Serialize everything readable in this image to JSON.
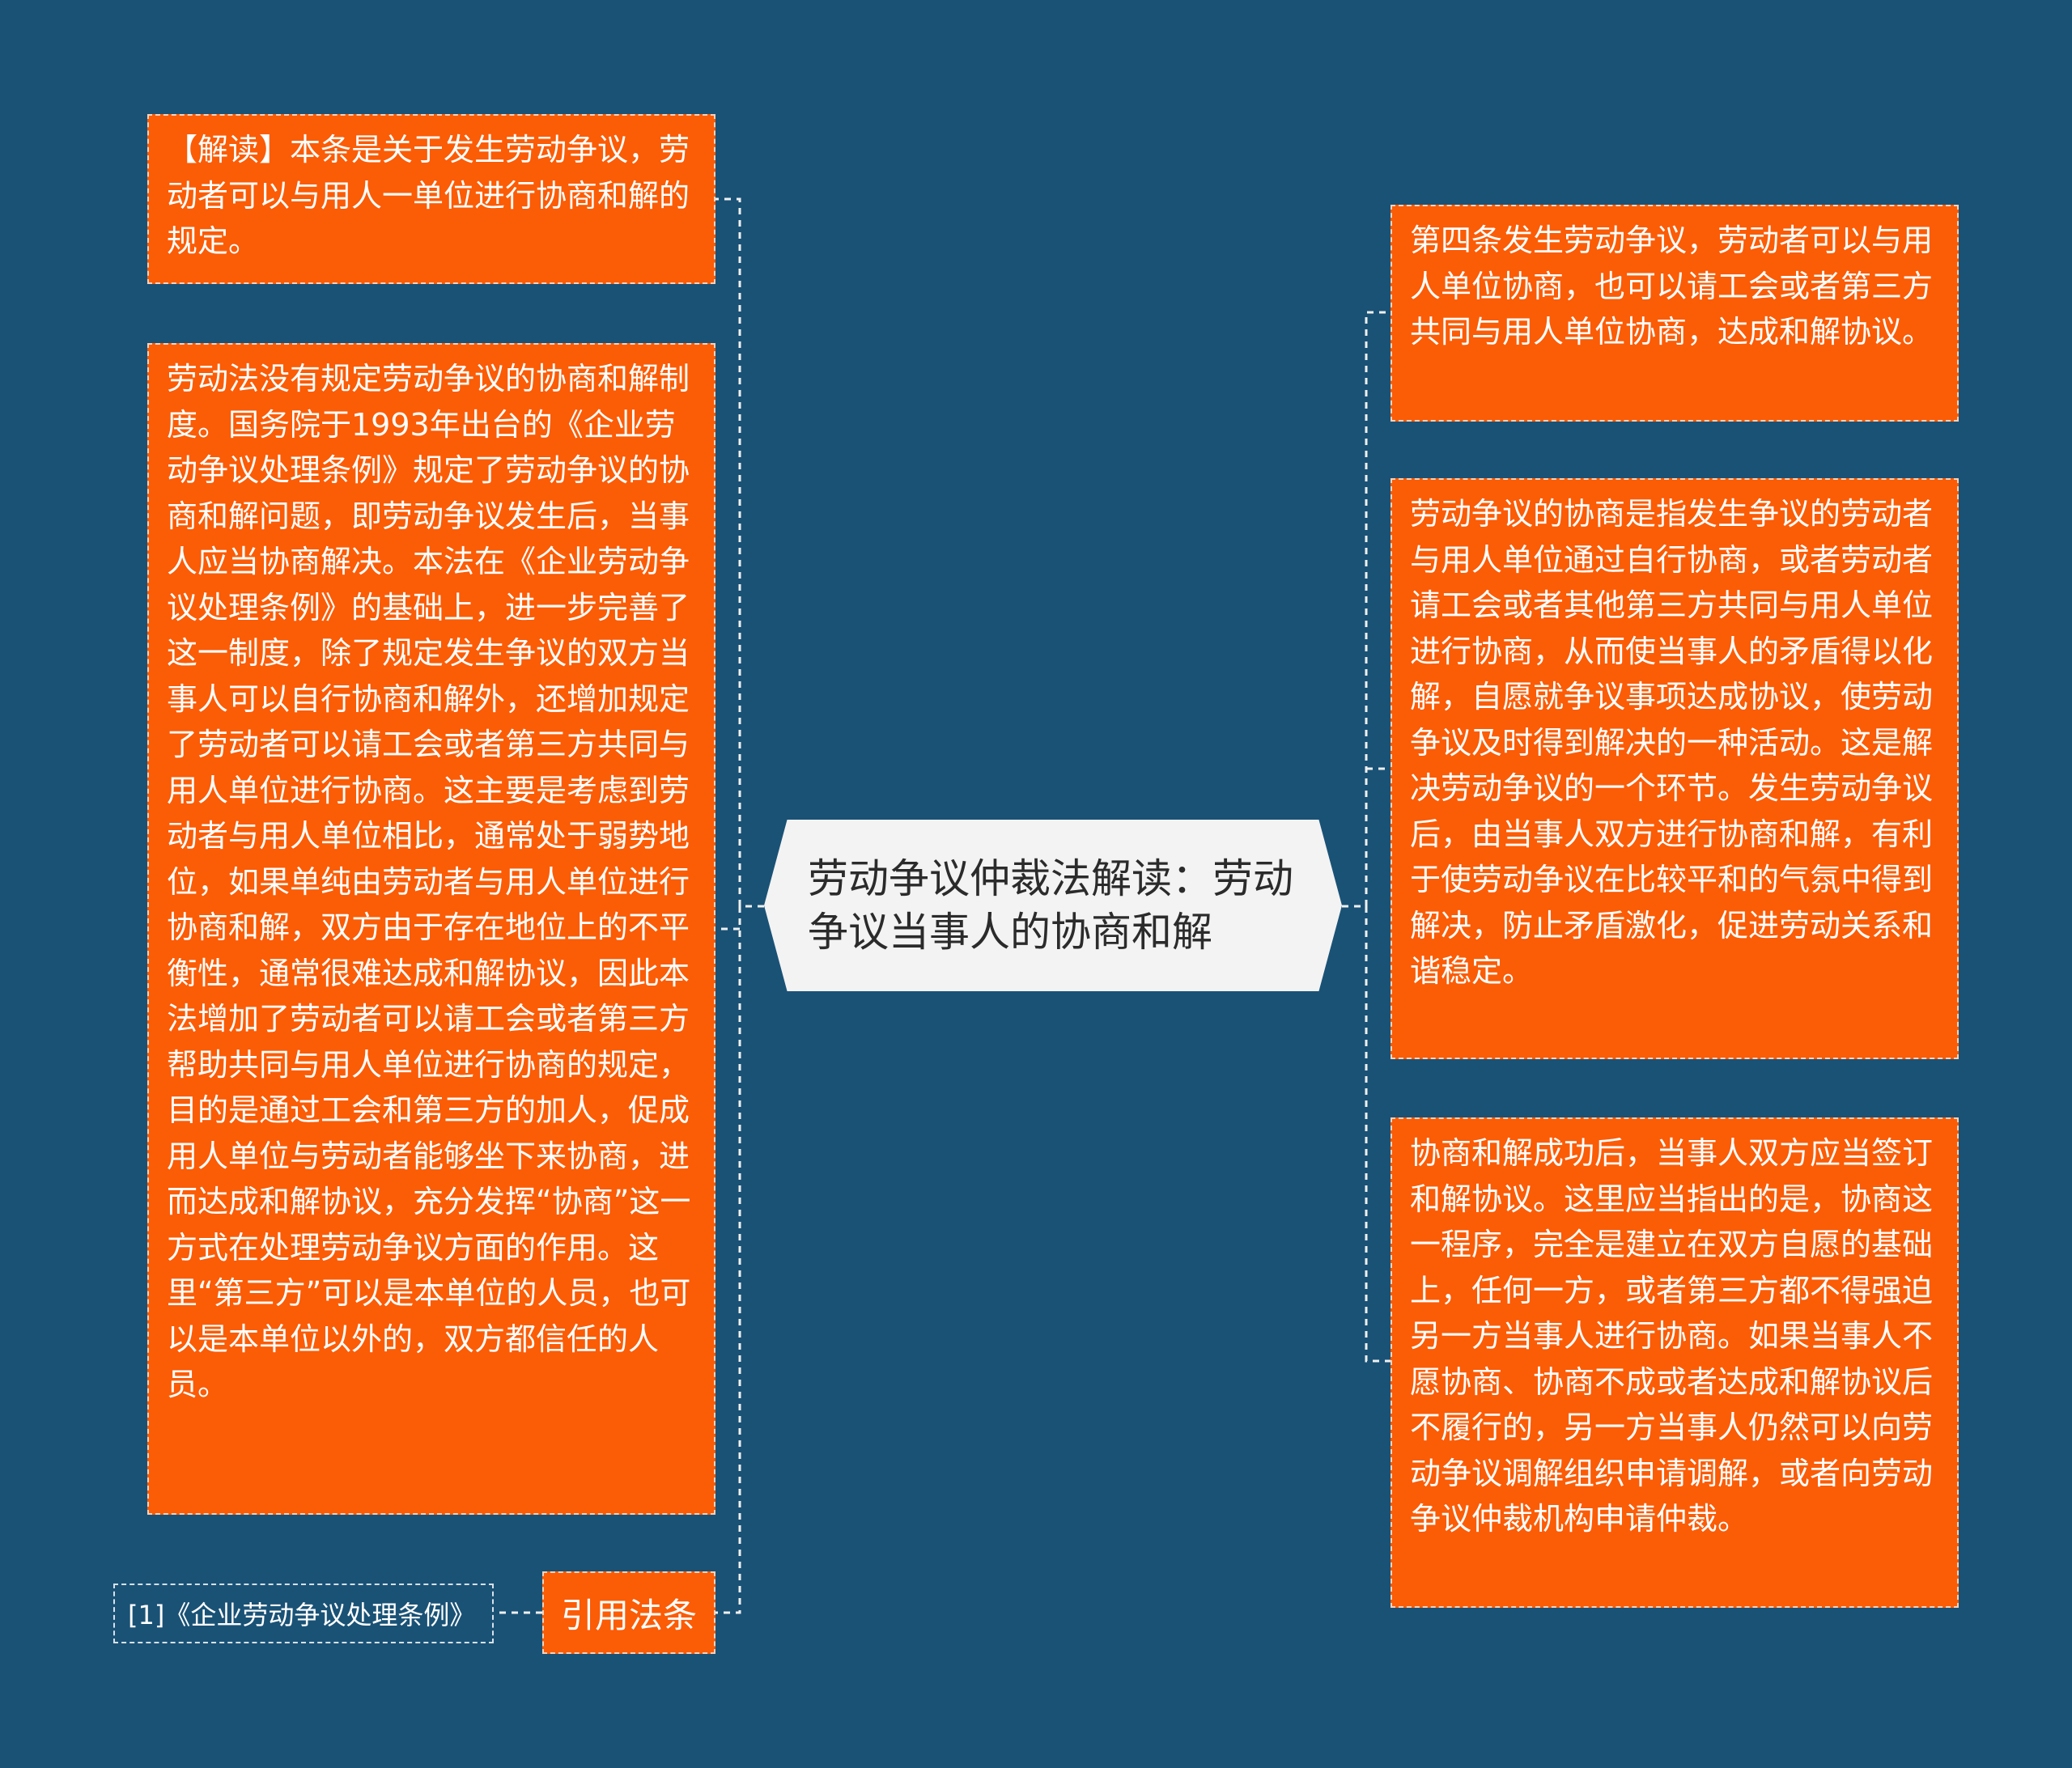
{
  "center": {
    "title": "劳动争议仲裁法解读：劳动争议当事人的协商和解"
  },
  "left": {
    "interpretation": "【解读】本条是关于发生劳动争议，劳动者可以与用人一单位进行协商和解的规定。",
    "detail": "劳动法没有规定劳动争议的协商和解制度。国务院于1993年出台的《企业劳动争议处理条例》规定了劳动争议的协商和解问题，即劳动争议发生后，当事人应当协商解决。本法在《企业劳动争议处理条例》的基础上，进一步完善了这一制度，除了规定发生争议的双方当事人可以自行协商和解外，还增加规定了劳动者可以请工会或者第三方共同与用人单位进行协商。这主要是考虑到劳动者与用人单位相比，通常处于弱势地位，如果单纯由劳动者与用人单位进行协商和解，双方由于存在地位上的不平衡性，通常很难达成和解协议，因此本法增加了劳动者可以请工会或者第三方帮助共同与用人单位进行协商的规定，目的是通过工会和第三方的加人，促成用人单位与劳动者能够坐下来协商，进而达成和解协议，充分发挥“协商”这一方式在处理劳动争议方面的作用。这里“第三方”可以是本单位的人员，也可以是本单位以外的，双方都信任的人员。",
    "cite_label": "引用法条",
    "reference": "[1]《企业劳动争议处理条例》"
  },
  "right": {
    "article": "第四条发生劳动争议，劳动者可以与用人单位协商，也可以请工会或者第三方共同与用人单位协商，达成和解协议。",
    "definition": "劳动争议的协商是指发生争议的劳动者与用人单位通过自行协商，或者劳动者请工会或者其他第三方共同与用人单位进行协商，从而使当事人的矛盾得以化解，自愿就争议事项达成协议，使劳动争议及时得到解决的一种活动。这是解决劳动争议的一个环节。发生劳动争议后，由当事人双方进行协商和解，有利于使劳动争议在比较平和的气氛中得到解决，防止矛盾激化，促进劳动关系和谐稳定。",
    "agreement": "协商和解成功后，当事人双方应当签订和解协议。这里应当指出的是，协商这一程序，完全是建立在双方自愿的基础上，任何一方，或者第三方都不得强迫另一方当事人进行协商。如果当事人不愿协商、协商不成或者达成和解协议后不履行的，另一方当事人仍然可以向劳动争议调解组织申请调解，或者向劳动争议仲裁机构申请仲裁。"
  },
  "colors": {
    "background": "#1a5276",
    "node": "#fb5c06",
    "center": "#f3f3f3"
  }
}
